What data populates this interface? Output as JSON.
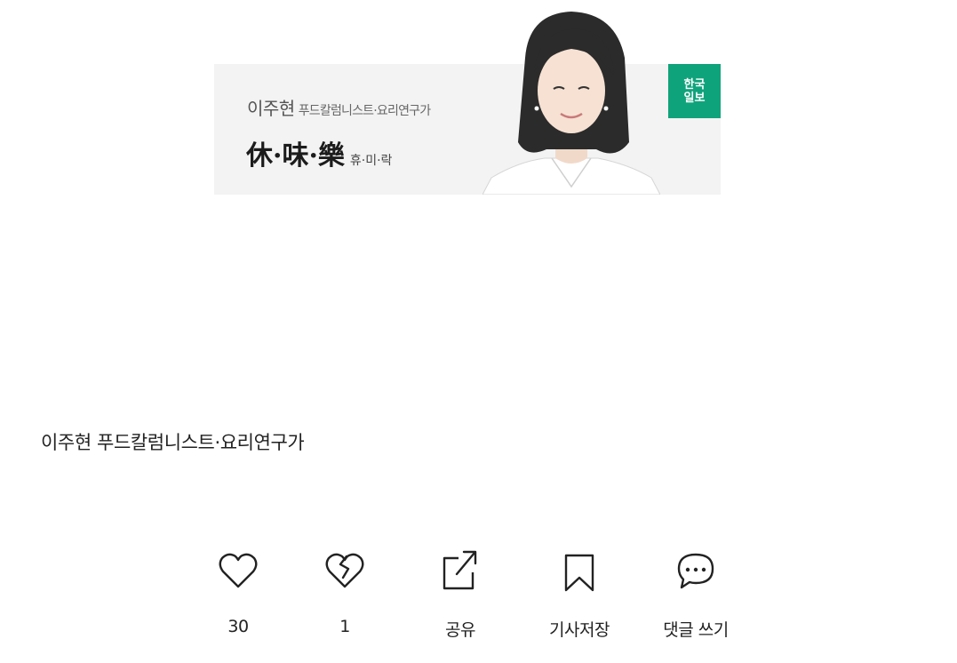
{
  "banner": {
    "name": "이주현",
    "role": "푸드칼럼니스트·요리연구가",
    "column_title_hanja": "休·味·樂",
    "column_title_hangul": "휴·미·락",
    "publisher": "한국일보",
    "publisher_color": "#0fa37b"
  },
  "byline": {
    "text": "이주현 푸드칼럼니스트·요리연구가"
  },
  "actions": {
    "like": {
      "label": "30",
      "icon": "heart-icon"
    },
    "dislike": {
      "label": "1",
      "icon": "broken-heart-icon"
    },
    "share": {
      "label": "공유",
      "icon": "share-icon"
    },
    "bookmark": {
      "label": "기사저장",
      "icon": "bookmark-icon"
    },
    "comment": {
      "label": "댓글 쓰기",
      "icon": "comment-icon"
    }
  }
}
